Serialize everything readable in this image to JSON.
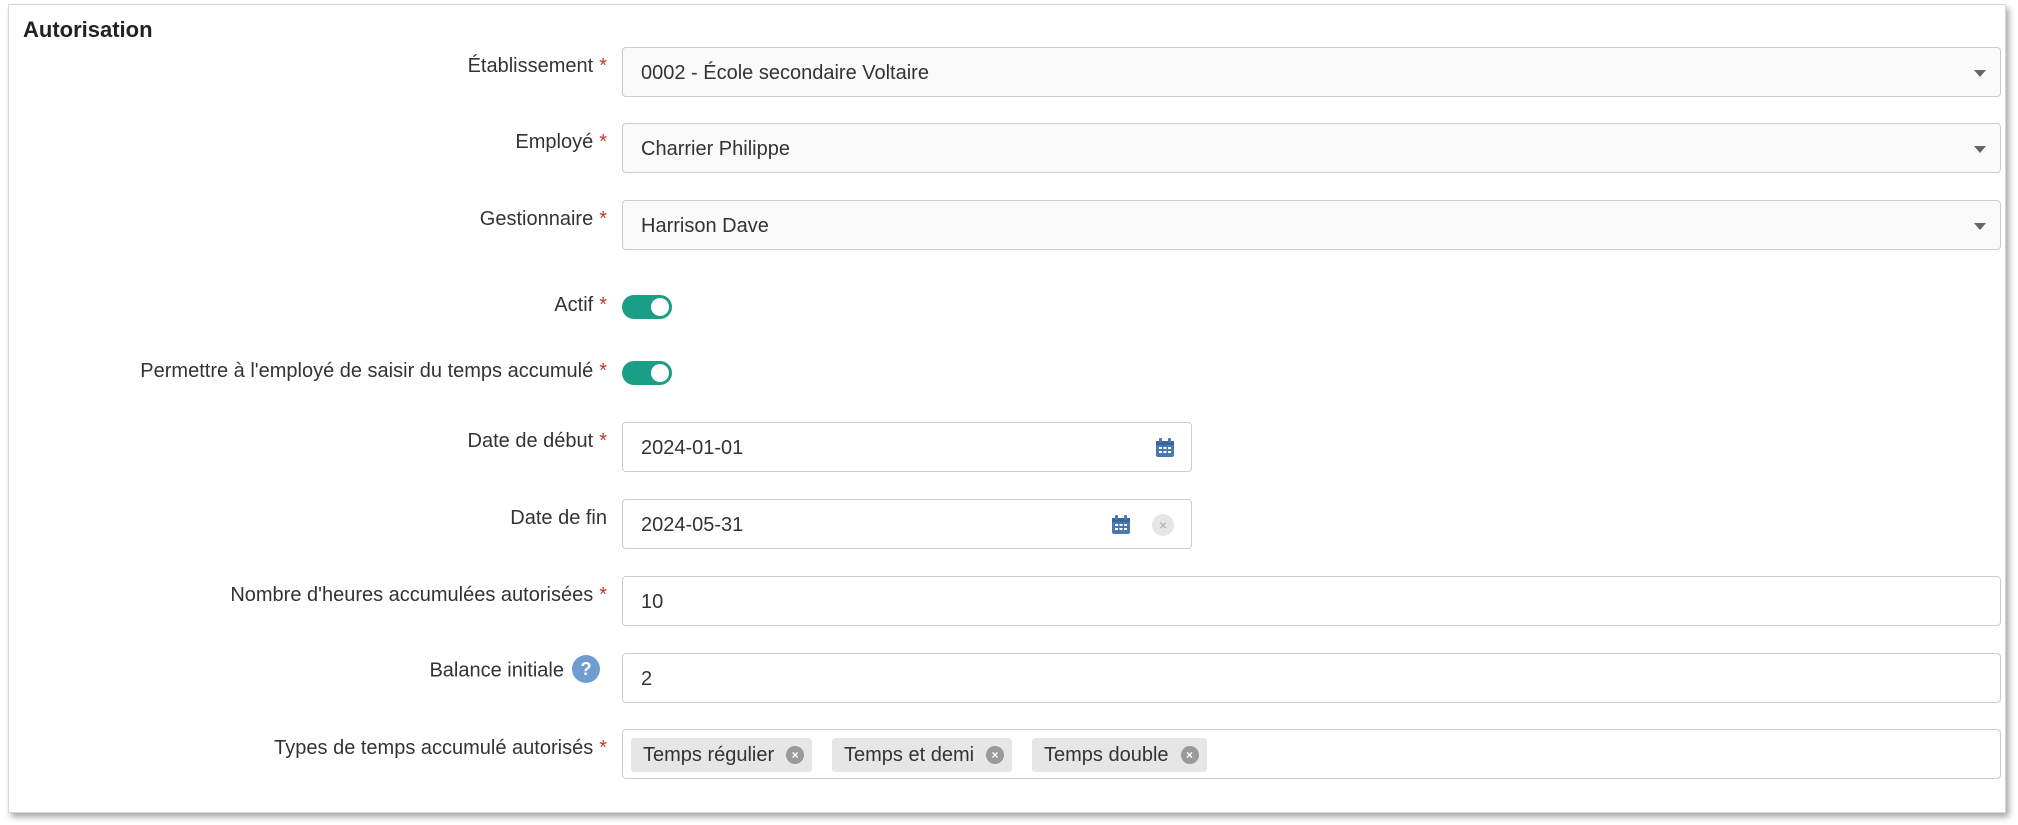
{
  "section_title": "Autorisation",
  "required_marker": "*",
  "fields": {
    "etablissement": {
      "label": "Établissement",
      "value": "0002 - École secondaire Voltaire"
    },
    "employe": {
      "label": "Employé",
      "value": "Charrier Philippe"
    },
    "gestionnaire": {
      "label": "Gestionnaire",
      "value": "Harrison Dave"
    },
    "actif": {
      "label": "Actif",
      "enabled": true
    },
    "permettre": {
      "label": "Permettre à l'employé de saisir du temps accumulé",
      "enabled": true
    },
    "date_debut": {
      "label": "Date de début",
      "value": "2024-01-01"
    },
    "date_fin": {
      "label": "Date de fin",
      "value": "2024-05-31"
    },
    "nombre_heures": {
      "label": "Nombre d'heures accumulées autorisées",
      "value": "10"
    },
    "balance": {
      "label": "Balance initiale",
      "value": "2",
      "help_icon": "?"
    },
    "types": {
      "label": "Types de temps accumulé autorisés",
      "tags": [
        "Temps régulier",
        "Temps et demi",
        "Temps double"
      ]
    }
  },
  "icons": {
    "calendar": "calendar-icon",
    "clear": "×",
    "tag_remove": "×"
  },
  "colors": {
    "toggle_on": "#1a9e85",
    "required": "#c0392b",
    "calendar": "#4a78b3",
    "help": "#6f9dd1"
  }
}
